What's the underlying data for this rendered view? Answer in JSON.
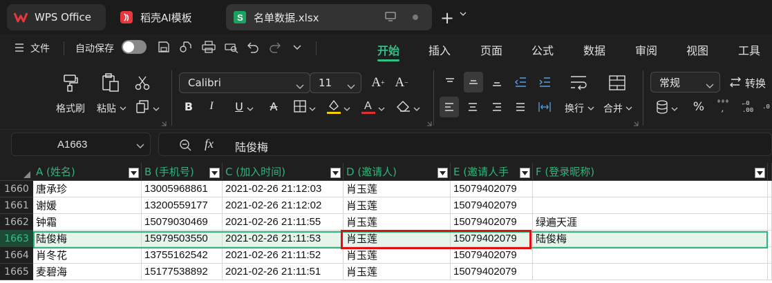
{
  "tabs": {
    "wps": "WPS Office",
    "template": "稻壳AI模板",
    "file": "名单数据.xlsx"
  },
  "menu": {
    "file": "文件",
    "autosave": "自动保存",
    "items": [
      "开始",
      "插入",
      "页面",
      "公式",
      "数据",
      "审阅",
      "视图",
      "工具"
    ]
  },
  "ribbon": {
    "format_painter": "格式刷",
    "paste": "粘贴",
    "font_name": "Calibri",
    "font_size": "11",
    "wrap": "换行",
    "merge": "合并",
    "number_format": "常规",
    "convert": "转换"
  },
  "formula_bar": {
    "name_box": "A1663",
    "value": "陆俊梅"
  },
  "grid": {
    "columns": [
      "A (姓名)",
      "B (手机号)",
      "C (加入时间)",
      "D (邀请人)",
      "E (邀请人手",
      "F (登录昵称)"
    ],
    "rows": [
      {
        "num": "1660",
        "cells": [
          "唐承珍",
          "13005968861",
          "2021-02-26 21:12:03",
          "肖玉莲",
          "15079402079",
          ""
        ]
      },
      {
        "num": "1661",
        "cells": [
          "谢媛",
          "13200559177",
          "2021-02-26 21:12:02",
          "肖玉莲",
          "15079402079",
          ""
        ]
      },
      {
        "num": "1662",
        "cells": [
          "钟霜",
          "15079030469",
          "2021-02-26 21:11:55",
          "肖玉莲",
          "15079402079",
          "绿遍天涯"
        ]
      },
      {
        "num": "1663",
        "cells": [
          "陆俊梅",
          "15979503550",
          "2021-02-26 21:11:53",
          "肖玉莲",
          "15079402079",
          "陆俊梅"
        ]
      },
      {
        "num": "1664",
        "cells": [
          "肖冬花",
          "13755162542",
          "2021-02-26 21:11:52",
          "肖玉莲",
          "15079402079",
          ""
        ]
      },
      {
        "num": "1665",
        "cells": [
          "麦碧海",
          "15177538892",
          "2021-02-26 21:11:51",
          "肖玉莲",
          "15079402079",
          ""
        ]
      }
    ]
  }
}
